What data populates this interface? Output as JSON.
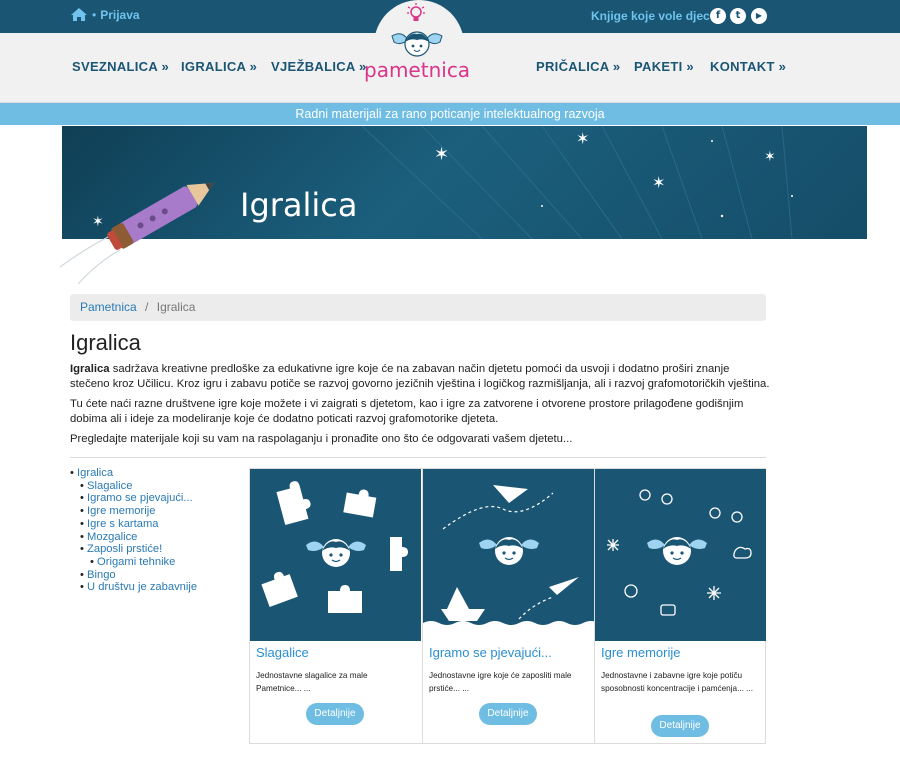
{
  "topbar": {
    "login_label": "Prijava",
    "tagline": "Knjige koje vole djecu",
    "social": [
      {
        "icon": "facebook-icon",
        "glyph": "f"
      },
      {
        "icon": "twitter-icon",
        "glyph": "t"
      },
      {
        "icon": "youtube-icon",
        "glyph": "▶"
      }
    ]
  },
  "nav": {
    "left": [
      "SVEZNALICA »",
      "IGRALICA »",
      "VJEŽBALICA »"
    ],
    "right": [
      "PRIČALICA »",
      "PAKETI »",
      "KONTAKT »"
    ],
    "logo_text": "pametnica"
  },
  "strip_text": "Radni materijali za rano poticanje intelektualnog razvoja",
  "banner": {
    "title": "Igralica"
  },
  "breadcrumb": {
    "home": "Pametnica",
    "separator": "/",
    "current": "Igralica"
  },
  "page": {
    "title": "Igralica",
    "intro_bold": "Igralica",
    "intro_p1": " sadržava kreativne predloške za edukativne igre koje će na zabavan način djetetu pomoći da usvoji i dodatno proširi znanje stečeno kroz Učilicu. Kroz igru i zabavu potiče se razvoj govorno jezičnih vještina i logičkog razmišljanja, ali i razvoj grafomotoričkih vještina.",
    "intro_p2": "Tu ćete naći razne društvene igre koje možete i vi zaigrati s djetetom, kao i igre za zatvorene i otvorene prostore prilagođene godišnjim dobima ali i ideje za modeliranje koje će dodatno poticati razvoj grafomotorike djeteta.",
    "intro_p3": "Pregledajte materijale koji su vam na raspolaganju i pronađite ono što će odgovarati vašem djetetu..."
  },
  "tree": {
    "root": "Igralica",
    "items": [
      "Slagalice",
      "Igramo se pjevajući...",
      "Igre memorije",
      "Igre s kartama",
      "Mozgalice",
      "Zaposli prstiće!"
    ],
    "sub_items": [
      "Origami tehnike"
    ],
    "tail_items": [
      "Bingo",
      "U društvu je zabavnije"
    ]
  },
  "cards": [
    {
      "title": "Slagalice",
      "desc": "Jednostavne slagalice za male Pametnice... ...",
      "button": "Detaljnije"
    },
    {
      "title": "Igramo se pjevajući...",
      "desc": "Jednostavne igre koje će zaposliti male prstiće... ...",
      "button": "Detaljnije"
    },
    {
      "title": "Igre memorije",
      "desc": "Jednostavne i zabavne igre koje potiču sposobnosti koncentracije i pamćenja... ...",
      "button": "Detaljnije"
    }
  ],
  "colors": {
    "brand_dark": "#1b5574",
    "brand_light": "#6fbde3",
    "logo_pink": "#d9358a",
    "link_blue": "#2a7ab5"
  }
}
